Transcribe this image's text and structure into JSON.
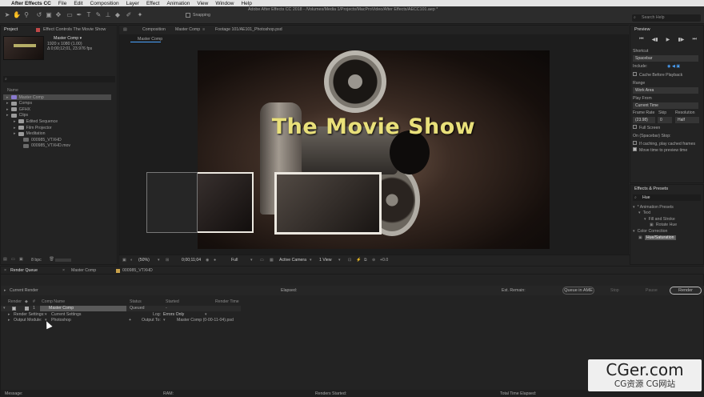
{
  "menubar": {
    "apple": "",
    "items": [
      "After Effects CC",
      "File",
      "Edit",
      "Composition",
      "Layer",
      "Effect",
      "Animation",
      "View",
      "Window",
      "Help"
    ]
  },
  "titlebar": {
    "title": "Adobe After Effects CC 2018 - /Volumes/Media 1/Projects/MacProVideo/After Effects/AECC101.aep *"
  },
  "toolbar": {
    "snapping_label": "Snapping",
    "search_help_placeholder": "Search Help"
  },
  "project": {
    "tab": "Project",
    "effect_controls_tab": "Effect Controls The Movie Show",
    "selected_item_name": "Master Comp ▾",
    "selected_item_info1": "1920 x 1080 (1.00)",
    "selected_item_info2": "Δ 0;00;12;01, 23.976 fps",
    "col_name": "Name",
    "items": [
      {
        "label": "Master Comp",
        "type": "comp",
        "indent": 0,
        "selected": true
      },
      {
        "label": "Comps",
        "type": "folder",
        "indent": 0
      },
      {
        "label": "GFHX",
        "type": "folder",
        "indent": 0
      },
      {
        "label": "Clips",
        "type": "folder",
        "indent": 0
      },
      {
        "label": "Edited Sequence",
        "type": "folder",
        "indent": 1
      },
      {
        "label": "Film Projector",
        "type": "folder",
        "indent": 1
      },
      {
        "label": "Meditation",
        "type": "folder",
        "indent": 1
      },
      {
        "label": "000985_VTXHD",
        "type": "file",
        "indent": 2
      },
      {
        "label": "000985_VTXHD.mov",
        "type": "file",
        "indent": 2
      }
    ],
    "bpc": "8 bpc"
  },
  "viewer": {
    "comp_tab": "Composition",
    "comp_name": "Master Comp",
    "footage_tab": "Footage 101/AE101_Photoshop.psd",
    "breadcrumb": "Master Comp",
    "title_text": "The Movie Show",
    "zoom": "(50%)",
    "timecode": "0;00;11;04",
    "resolution": "Full",
    "camera": "Active Camera",
    "views": "1 View",
    "exposure": "+0.0"
  },
  "preview": {
    "tab": "Preview",
    "shortcut_label": "Shortcut",
    "shortcut_value": "Spacebar",
    "include_label": "Include:",
    "cache_label": "Cache Before Playback",
    "range_label": "Range",
    "range_value": "Work Area",
    "play_from_label": "Play From",
    "play_from_value": "Current Time",
    "frame_rate_label": "Frame Rate",
    "skip_label": "Skip",
    "resolution_label": "Resolution",
    "frame_rate_value": "(23.98)",
    "skip_value": "0",
    "resolution_value": "Half",
    "full_screen_label": "Full Screen",
    "on_stop_label": "On (Spacebar) Stop:",
    "if_caching_label": "If caching, play cached frames",
    "move_time_label": "Move time to preview time"
  },
  "effects": {
    "tab": "Effects & Presets",
    "search_value": "Hue",
    "items": [
      {
        "label": "* Animation Presets",
        "indent": 0,
        "type": "folder"
      },
      {
        "label": "Text",
        "indent": 1,
        "type": "folder"
      },
      {
        "label": "Fill and Stroke",
        "indent": 2,
        "type": "folder"
      },
      {
        "label": "Rotate Hue",
        "indent": 3,
        "type": "file"
      },
      {
        "label": "Color Correction",
        "indent": 0,
        "type": "folder"
      },
      {
        "label": "Hue/Saturation",
        "indent": 1,
        "type": "effect",
        "selected": true
      }
    ]
  },
  "bottom": {
    "tabs": [
      "Render Queue",
      "Master Comp",
      "000985_VTXHD"
    ],
    "current_render": "Current Render",
    "elapsed": "Elapsed:",
    "est_remain": "Est. Remain:",
    "queue_ame": "Queue in AME",
    "stop": "Stop",
    "pause": "Pause",
    "render": "Render",
    "cols": [
      "Render",
      "#",
      "Comp Name",
      "Status",
      "Started",
      "Render Time"
    ],
    "item": {
      "num": "1",
      "comp": "Master Comp",
      "status": "Queued",
      "started": "-",
      "render_time": ""
    },
    "render_settings_label": "Render Settings:",
    "render_settings_value": "Current Settings",
    "log_label": "Log:",
    "log_value": "Errors Only",
    "output_module_label": "Output Module:",
    "output_module_value": "Photoshop",
    "output_to_label": "Output To:",
    "output_to_value": "Master Comp (0-00-11-04).psd",
    "status_message": "Message:",
    "status_ram": "RAM:",
    "status_renders_started": "Renders Started:",
    "status_total_time": "Total Time Elapsed:"
  },
  "watermark": {
    "big": "CGer.com",
    "small": "CG资源 CG网站"
  }
}
